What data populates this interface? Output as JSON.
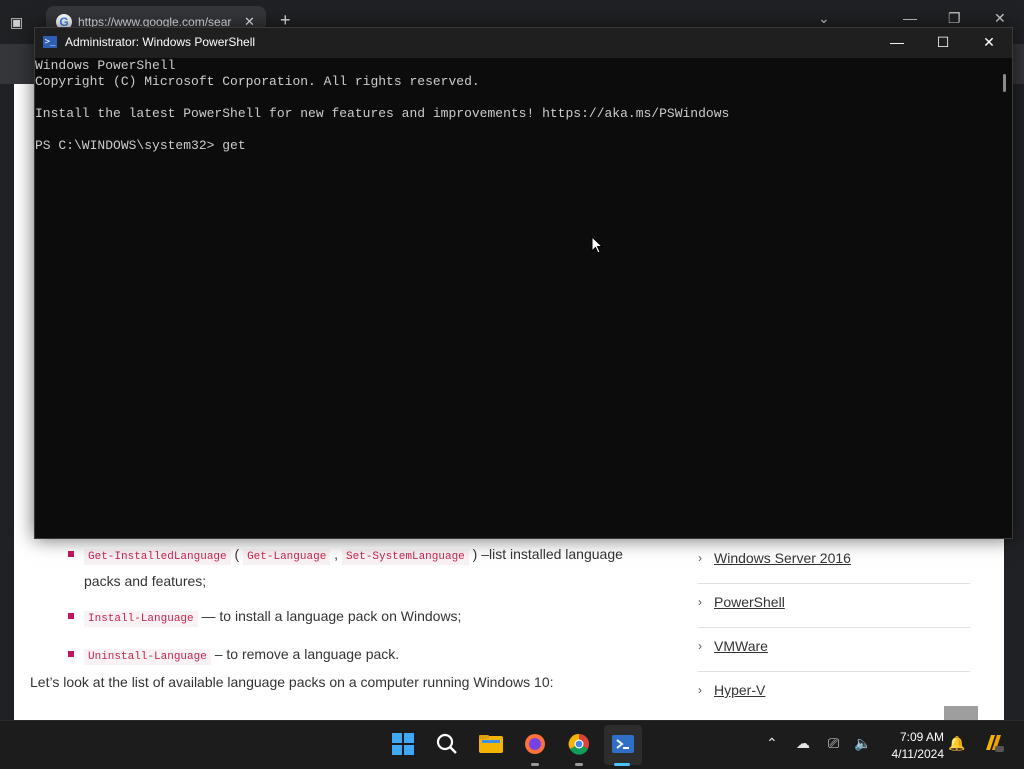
{
  "browser": {
    "tab_title": "https://www.google.com/sear",
    "new_tab_label": "+",
    "favicon": "G"
  },
  "article": {
    "bullets": [
      {
        "code1": "Get-InstalledLanguage",
        "open": " ( ",
        "code2": "Get-Language",
        "sep": " , ",
        "code3": "Set-SystemLanguage",
        "text": " ) –list installed language packs and features;"
      },
      {
        "code1": "Install-Language",
        "text": " — to install a language pack on Windows;"
      },
      {
        "code1": "Uninstall-Language",
        "text": " – to remove a language pack."
      }
    ],
    "intro": "Let’s look at the list of available language packs on a computer running Windows 10:"
  },
  "sidebar": {
    "links": [
      "Windows Server 2016",
      "PowerShell",
      "VMWare",
      "Hyper-V"
    ]
  },
  "powershell": {
    "title": "Administrator: Windows PowerShell",
    "lines": [
      "Windows PowerShell",
      "Copyright (C) Microsoft Corporation. All rights reserved.",
      "",
      "Install the latest PowerShell for new features and improvements! https://aka.ms/PSWindows",
      "",
      "PS C:\\WINDOWS\\system32> get"
    ]
  },
  "taskbar": {
    "time": "7:09 AM",
    "date": "4/11/2024"
  },
  "colors": {
    "terminal_bg": "#0c0c0c",
    "terminal_text": "#cccccc",
    "taskbar_bg": "#1c1c1c",
    "code_color": "#c7254e"
  }
}
